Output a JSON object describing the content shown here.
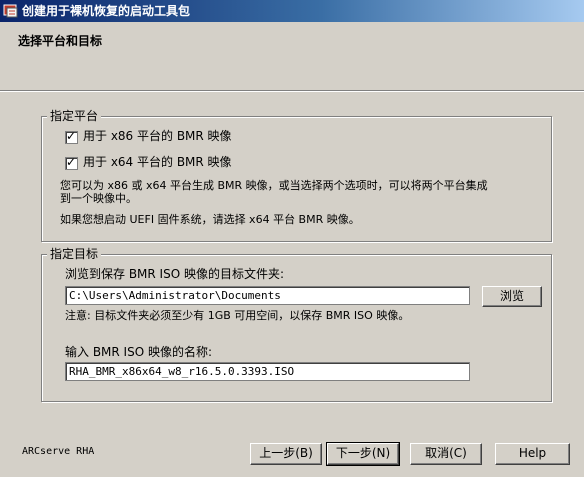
{
  "window": {
    "title": "创建用于裸机恢复的启动工具包",
    "icon": "app-icon"
  },
  "header": {
    "title": "选择平台和目标"
  },
  "platform_group": {
    "legend": "指定平台",
    "x86_checkbox": {
      "label": "用于 x86 平台的 BMR 映像",
      "checked": true
    },
    "x64_checkbox": {
      "label": "用于 x64 平台的 BMR 映像",
      "checked": true
    },
    "info_line1": "您可以为 x86 或 x64 平台生成 BMR 映像，或当选择两个选项时，可以将两个平台集成",
    "info_line2": "到一个映像中。",
    "uefi_note": "如果您想启动 UEFI 固件系统，请选择 x64 平台 BMR 映像。"
  },
  "target_group": {
    "legend": "指定目标",
    "folder_label": "浏览到保存 BMR ISO 映像的目标文件夹:",
    "folder_value": "C:\\Users\\Administrator\\Documents",
    "browse_button": "浏览",
    "space_note": "注意: 目标文件夹必须至少有 1GB 可用空间，以保存 BMR ISO 映像。",
    "name_label": "输入 BMR ISO 映像的名称:",
    "name_value": "RHA_BMR_x86x64_w8_r16.5.0.3393.ISO"
  },
  "footer": {
    "brand": "ARCserve RHA",
    "back_button": "上一步(B)",
    "next_button": "下一步(N)",
    "cancel_button": "取消(C)",
    "help_button": "Help"
  }
}
